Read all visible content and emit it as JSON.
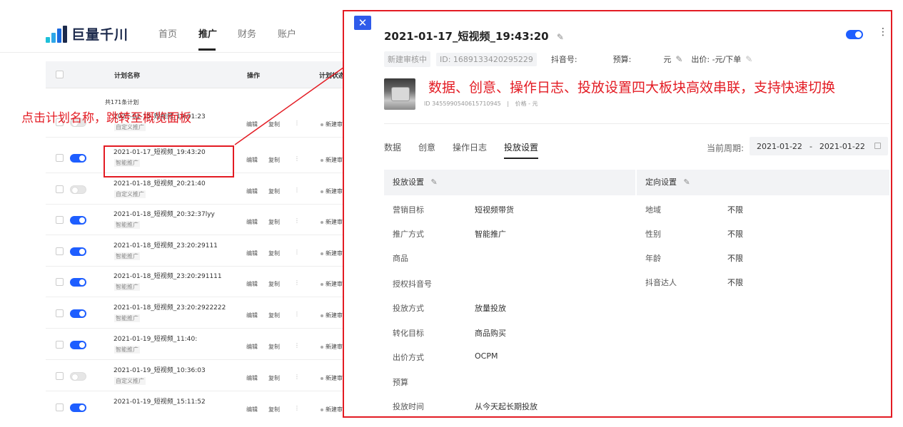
{
  "nav": {
    "logo_text": "巨量千川",
    "tabs": [
      "首页",
      "推广",
      "财务",
      "账户"
    ],
    "active_tab": "推广"
  },
  "table": {
    "headers": {
      "name": "计划名称",
      "ops": "操作",
      "status": "计划状态"
    },
    "count": "共171条计划",
    "rows": [
      {
        "name": "2021-01-15_短视频_19:01:23",
        "tag": "自定义推广",
        "on": false
      },
      {
        "name": "2021-01-17_短视频_19:43:20",
        "tag": "智能推广",
        "on": true
      },
      {
        "name": "2021-01-18_短视频_20:21:40",
        "tag": "自定义推广",
        "on": false
      },
      {
        "name": "2021-01-18_短视频_20:32:37lyy",
        "tag": "智能推广",
        "on": true
      },
      {
        "name": "2021-01-18_短视频_23:20:29111",
        "tag": "智能推广",
        "on": true
      },
      {
        "name": "2021-01-18_短视频_23:20:291111",
        "tag": "智能推广",
        "on": true
      },
      {
        "name": "2021-01-18_短视频_23:20:2922222",
        "tag": "智能推广",
        "on": true
      },
      {
        "name": "2021-01-19_短视频_11:40:",
        "tag": "智能推广",
        "on": true
      },
      {
        "name": "2021-01-19_短视频_10:36:03",
        "tag": "自定义推广",
        "on": false
      },
      {
        "name": "2021-01-19_短视频_15:11:52",
        "tag": "",
        "on": true
      }
    ],
    "op_edit": "编辑",
    "op_copy": "复制",
    "status_text": "新建审核中",
    "more": "⋮"
  },
  "annotations": {
    "left": "点击计划名称，跳转至概览面板",
    "right": "数据、创意、操作日志、投放设置四大板块高效串联，支持快速切换"
  },
  "panel": {
    "close": "✕",
    "title": "2021-01-17_短视频_19:43:20",
    "edit_icon": "✎",
    "more_icon": "⋮",
    "status_chip": "新建审核中",
    "id_chip": "ID: 1689133420295229",
    "douyin_label": "抖音号:",
    "budget_label": "预算:",
    "budget_value": "元",
    "bid": "出价: -元/下单",
    "product_id": "ID 3455990540615710945",
    "product_sep": "|",
    "product_price": "价格  - 元",
    "tabs": [
      "数据",
      "创意",
      "操作日志",
      "投放设置"
    ],
    "active_tab": "投放设置",
    "period_label": "当前周期:",
    "date_start": "2021-01-22",
    "date_sep": "-",
    "date_end": "2021-01-22",
    "delivery": {
      "title": "投放设置",
      "items": [
        {
          "label": "营销目标",
          "value": "短视频带货"
        },
        {
          "label": "推广方式",
          "value": "智能推广"
        },
        {
          "label": "商品",
          "value": ""
        },
        {
          "label": "授权抖音号",
          "value": ""
        },
        {
          "label": "投放方式",
          "value": "放量投放"
        },
        {
          "label": "转化目标",
          "value": "商品购买"
        },
        {
          "label": "出价方式",
          "value": "OCPM"
        },
        {
          "label": "预算",
          "value": ""
        },
        {
          "label": "投放时间",
          "value": "从今天起长期投放"
        }
      ]
    },
    "targeting": {
      "title": "定向设置",
      "items": [
        {
          "label": "地域",
          "value": "不限"
        },
        {
          "label": "性别",
          "value": "不限"
        },
        {
          "label": "年龄",
          "value": "不限"
        },
        {
          "label": "抖音达人",
          "value": "不限"
        }
      ]
    }
  },
  "colors": {
    "accent": "#1e5eff",
    "annotation_red": "#e31b23",
    "status_green": "#35b35a"
  }
}
